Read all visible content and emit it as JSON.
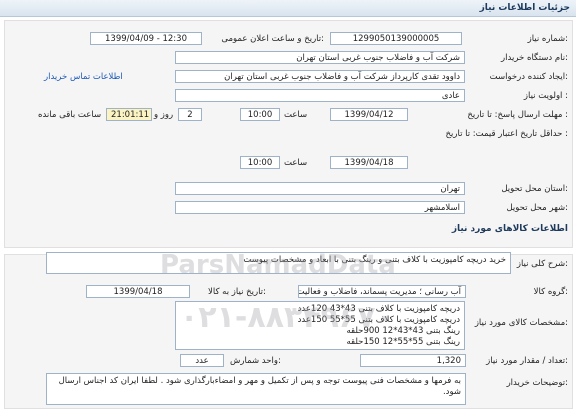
{
  "header": {
    "title": "جزئیات اطلاعات نیاز"
  },
  "fields": {
    "need_number_label": "شماره نیاز:",
    "need_number": "1299050139000005",
    "announce_label": "تاریخ و ساعت اعلان عمومی:",
    "announce_value": "1399/04/09 - 12:30",
    "buyer_label": "نام دستگاه خریدار:",
    "buyer_value": "شرکت آب و فاضلاب جنوب غربی استان تهران",
    "creator_label": "ایجاد کننده درخواست:",
    "creator_value": "داوود  تقدی  کارپرداز شرکت آب و فاضلاب جنوب غربی استان تهران",
    "contact_link": "اطلاعات تماس خریدار",
    "priority_label": "اولویت نیاز :",
    "priority_value": "عادی",
    "deadline_label": "مهلت ارسال پاسخ: تا تاریخ :",
    "deadline_date": "1399/04/12",
    "time_label": "ساعت",
    "deadline_time": "10:00",
    "days_value": "2",
    "days_label": "روز و",
    "remaining_time": "21:01:11",
    "remaining_label": "ساعت باقی مانده",
    "validity_label": "حداقل تاریخ اعتبار قیمت: تا تاریخ :",
    "validity_date": "1399/04/18",
    "validity_time": "10:00",
    "province_label": "استان محل تحویل:",
    "province_value": "تهران",
    "city_label": "شهر محل تحویل:",
    "city_value": "اسلامشهر"
  },
  "goods": {
    "section_title": "اطلاعات کالاهای مورد نیاز",
    "summary_label": "شرح کلی نیاز:",
    "summary_value": "خرید دریچه کامپوزیت با کلاف بتنی و رینگ بتنی با ابعاد و مشخصات پیوست",
    "group_label": "گروه کالا:",
    "group_value": "آب رسانی ؛ مدیریت پسماند، فاضلاب و فعالیت ها",
    "need_date_label": "تاریخ نیاز به کالا:",
    "need_date_value": "1399/04/18",
    "specs_label": "مشخصات کالای مورد نیاز:",
    "specs_lines": [
      "دریچه کامپوزیت با کلاف بتنی 43*43  120عدد",
      "دریچه کامپوزیت با کلاف بتنی  55*55  150عدد",
      "رینگ بتنی   43*43*12  900حلقه",
      "رینگ بتنی   55*55*12   150حلقه"
    ],
    "qty_label": "تعداد / مقدار مورد نیاز:",
    "qty_value": "1,320",
    "unit_label": "واحد شمارش:",
    "unit_value": "عدد",
    "buyer_notes_label": "توضیحات خریدار:",
    "buyer_notes": "به فرمها و مشخصات فنی پیوست توجه و پس از تکمیل و مهر و امضاءبارگذاری شود . لطفا ایران کد اجناس ارسال شود."
  },
  "watermark": {
    "brand": "ParsNamadData",
    "phone": "۰۲۱-۸۸۳۴۹۶۷۰"
  }
}
